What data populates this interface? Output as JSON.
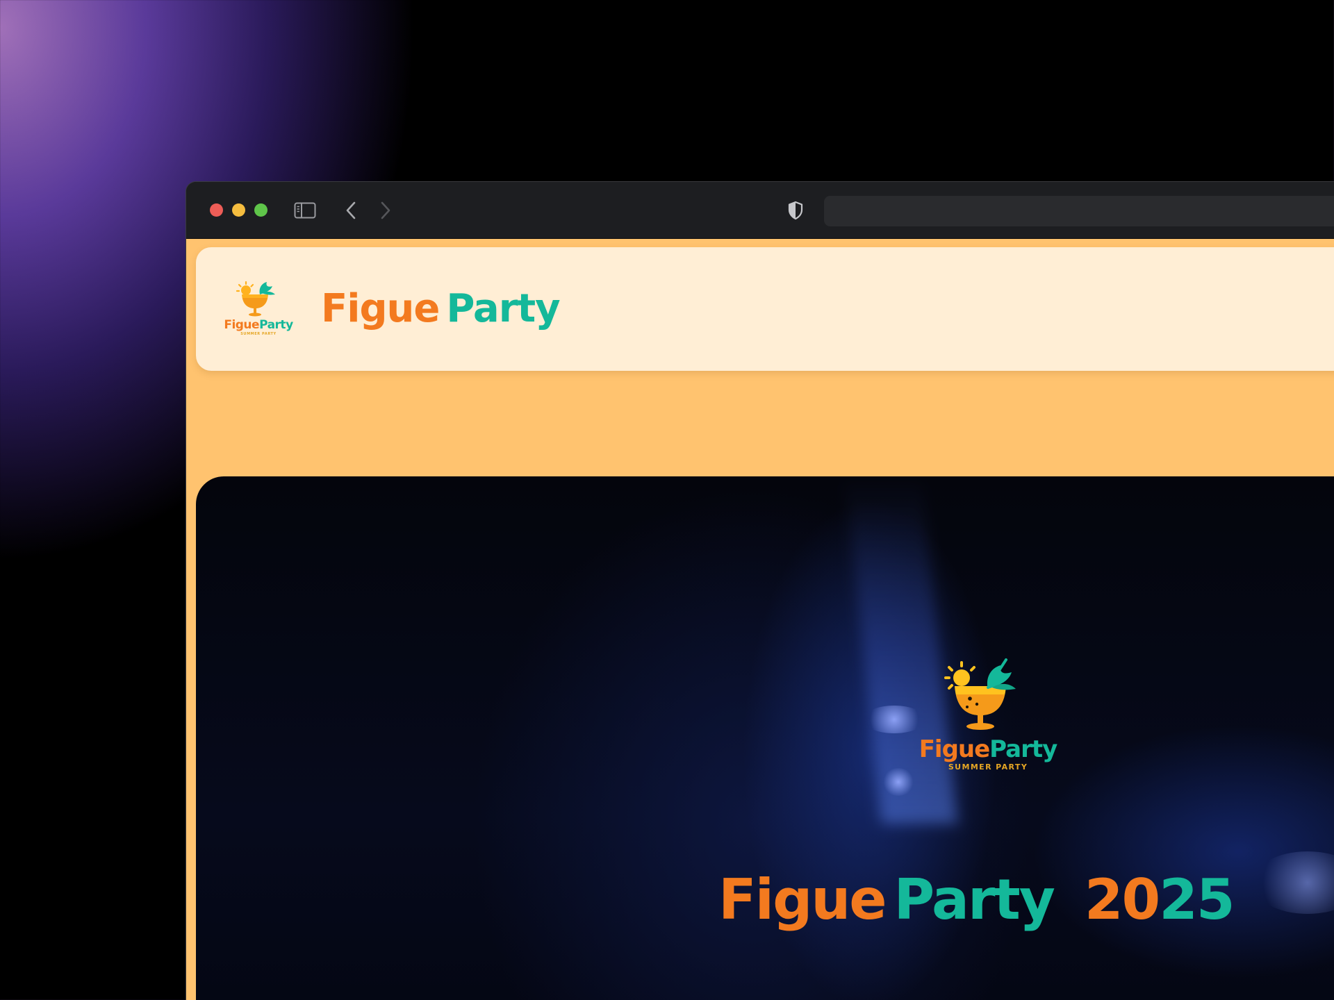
{
  "header": {
    "brand_word1": "Figue",
    "brand_word2": "Party",
    "logo_word1": "Figue",
    "logo_word2": "Party",
    "logo_tagline": "SUMMER PARTY"
  },
  "hero": {
    "logo_word1": "Figue",
    "logo_word2": "Party",
    "logo_tagline": "SUMMER PARTY",
    "title_word1": "Figue",
    "title_word2": "Party",
    "year_part1": "20",
    "year_part2": "25"
  },
  "colors": {
    "brand_orange": "#f37a1f",
    "brand_teal": "#14b89a",
    "page_background": "#ffc36f",
    "header_background": "#ffeed5"
  },
  "icons": [
    "sidebar-icon",
    "back-icon",
    "forward-icon",
    "shield-icon"
  ]
}
